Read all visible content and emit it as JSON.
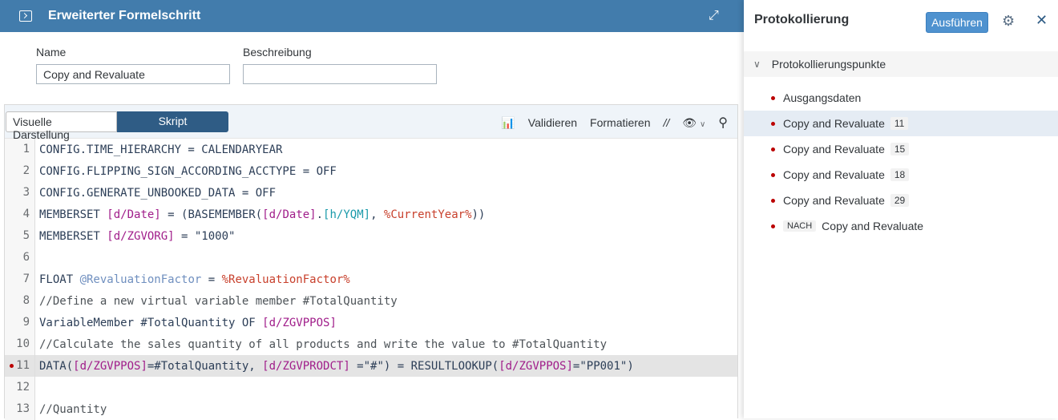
{
  "header": {
    "title": "Erweiterter Formelschritt",
    "icon": "console-icon",
    "expand_icon": "expand-icon"
  },
  "form": {
    "name_label": "Name",
    "name_value": "Copy and Revaluate",
    "desc_label": "Beschreibung",
    "desc_value": ""
  },
  "editor": {
    "tabs": [
      "Visuelle Darstellung",
      "Skript"
    ],
    "active_tab": "Skript",
    "toolbar": {
      "validate": "Validieren",
      "format": "Formatieren",
      "comment": "//"
    },
    "lines": [
      {
        "n": "1",
        "tokens": [
          {
            "t": "CONFIG.TIME_HIERARCHY = CALENDARYEAR",
            "c": ""
          }
        ]
      },
      {
        "n": "2",
        "tokens": [
          {
            "t": "CONFIG.FLIPPING_SIGN_ACCORDING_ACCTYPE = OFF",
            "c": ""
          }
        ]
      },
      {
        "n": "3",
        "tokens": [
          {
            "t": "CONFIG.GENERATE_UNBOOKED_DATA = OFF",
            "c": ""
          }
        ]
      },
      {
        "n": "4",
        "tokens": [
          {
            "t": "MEMBERSET ",
            "c": ""
          },
          {
            "t": "[d/Date]",
            "c": "m"
          },
          {
            "t": " = (BASEMEMBER(",
            "c": ""
          },
          {
            "t": "[d/Date]",
            "c": "m"
          },
          {
            "t": ".",
            "c": ""
          },
          {
            "t": "[h/YQM]",
            "c": "t"
          },
          {
            "t": ", ",
            "c": ""
          },
          {
            "t": "%CurrentYear%",
            "c": "r"
          },
          {
            "t": "))",
            "c": ""
          }
        ]
      },
      {
        "n": "5",
        "tokens": [
          {
            "t": "MEMBERSET ",
            "c": ""
          },
          {
            "t": "[d/ZGVORG]",
            "c": "m"
          },
          {
            "t": " = \"1000\"",
            "c": ""
          }
        ]
      },
      {
        "n": "6",
        "tokens": []
      },
      {
        "n": "7",
        "tokens": [
          {
            "t": "FLOAT ",
            "c": ""
          },
          {
            "t": "@RevaluationFactor",
            "c": "v"
          },
          {
            "t": " = ",
            "c": ""
          },
          {
            "t": "%RevaluationFactor%",
            "c": "r"
          }
        ]
      },
      {
        "n": "8",
        "tokens": [
          {
            "t": "//Define a new virtual variable member #TotalQuantity",
            "c": "c"
          }
        ]
      },
      {
        "n": "9",
        "tokens": [
          {
            "t": "VariableMember #TotalQuantity OF ",
            "c": ""
          },
          {
            "t": "[d/ZGVPPOS]",
            "c": "m"
          }
        ]
      },
      {
        "n": "10",
        "tokens": [
          {
            "t": "//Calculate the sales quantity of all products and write the value to #TotalQuantity",
            "c": "c"
          }
        ]
      },
      {
        "n": "11",
        "breakpoint": true,
        "tokens": [
          {
            "t": "DATA(",
            "c": ""
          },
          {
            "t": "[d/ZGVPPOS]",
            "c": "m"
          },
          {
            "t": "=#TotalQuantity, ",
            "c": ""
          },
          {
            "t": "[d/ZGVPRODCT]",
            "c": "m"
          },
          {
            "t": " =\"#\") = RESULTLOOKUP(",
            "c": ""
          },
          {
            "t": "[d/ZGVPPOS]",
            "c": "m"
          },
          {
            "t": "=\"PP001\")",
            "c": ""
          }
        ]
      },
      {
        "n": "12",
        "tokens": []
      },
      {
        "n": "13",
        "tokens": [
          {
            "t": "//Quantity",
            "c": "c"
          }
        ]
      }
    ]
  },
  "log": {
    "title": "Protokollierung",
    "run": "Ausführen",
    "section": "Protokollierungspunkte",
    "items": [
      {
        "label": "Ausgangsdaten",
        "badge": null,
        "prefix": null
      },
      {
        "label": "Copy and Revaluate",
        "badge": "11",
        "prefix": null,
        "selected": true
      },
      {
        "label": "Copy and Revaluate",
        "badge": "15",
        "prefix": null
      },
      {
        "label": "Copy and Revaluate",
        "badge": "18",
        "prefix": null
      },
      {
        "label": "Copy and Revaluate",
        "badge": "29",
        "prefix": null
      },
      {
        "label": "Copy and Revaluate",
        "badge": null,
        "prefix": "NACH"
      }
    ]
  },
  "colors": {
    "header": "#427cac",
    "accent": "#2f5c85",
    "breakpoint": "#bb0000"
  }
}
